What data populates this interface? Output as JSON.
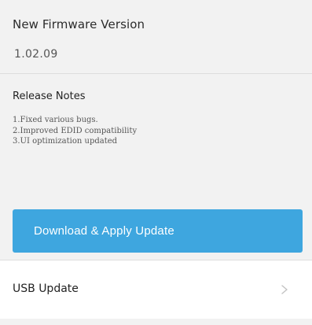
{
  "firmware": {
    "title": "New Firmware Version",
    "version": "1.02.09"
  },
  "release_notes": {
    "title": "Release Notes",
    "items": [
      "1.Fixed various bugs.",
      "2.Improved EDID compatibility",
      "3.UI optimization updated"
    ]
  },
  "actions": {
    "apply_label": "Download & Apply Update"
  },
  "usb_update": {
    "label": "USB Update",
    "icon": "chevron-right-icon"
  },
  "colors": {
    "accent": "#3ea6df",
    "section_background": "#f2f2f2",
    "divider": "#dedede"
  }
}
